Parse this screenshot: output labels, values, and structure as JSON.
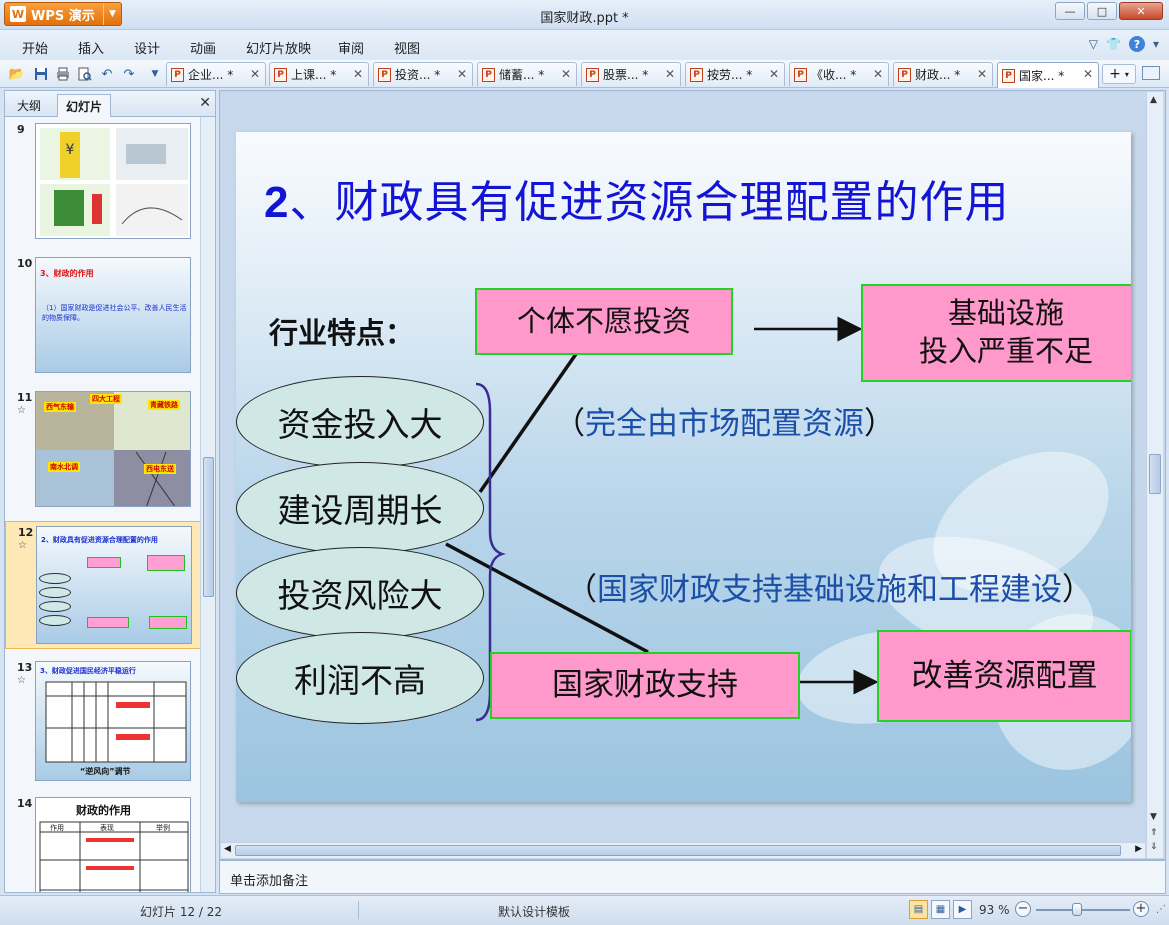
{
  "app": {
    "name": "WPS 演示",
    "logo_letter": "W",
    "window_title": "国家财政.ppt *"
  },
  "window_controls": {
    "minimize": "—",
    "maximize": "□",
    "close": "✕"
  },
  "menu": [
    "开始",
    "插入",
    "设计",
    "动画",
    "幻灯片放映",
    "审阅",
    "视图"
  ],
  "menu_right": {
    "collapse": "▽",
    "skin": "👕",
    "help": "?",
    "help_drop": "▾"
  },
  "quick_access_icons": [
    "open-folder-icon",
    "save-icon",
    "print-icon",
    "print-preview-icon",
    "undo-icon",
    "redo-icon",
    "customize-icon"
  ],
  "doc_tabs": [
    {
      "label": "企业... *",
      "active": false
    },
    {
      "label": "上课... *",
      "active": false
    },
    {
      "label": "投资... *",
      "active": false
    },
    {
      "label": "储蓄... *",
      "active": false
    },
    {
      "label": "股票... *",
      "active": false
    },
    {
      "label": "按劳... *",
      "active": false
    },
    {
      "label": "《收... *",
      "active": false
    },
    {
      "label": "财政... *",
      "active": false
    },
    {
      "label": "国家... *",
      "active": true
    }
  ],
  "left_panel": {
    "tabs": [
      "大纲",
      "幻灯片"
    ],
    "active_tab": "幻灯片",
    "close": "✕",
    "thumbnails": [
      {
        "num": "9",
        "star": false,
        "selected": false
      },
      {
        "num": "10",
        "star": false,
        "selected": false,
        "title": "3、财政的作用",
        "body": "（1）国家财政是促进社会公平、改善人民生活的物质保障。"
      },
      {
        "num": "11",
        "star": true,
        "selected": false,
        "tags": [
          "西气东输",
          "四大工程",
          "青藏铁路",
          "南水北调",
          "西电东送"
        ]
      },
      {
        "num": "12",
        "star": true,
        "selected": true,
        "title": "2、财政具有促进资源合理配置的作用"
      },
      {
        "num": "13",
        "star": true,
        "selected": false,
        "title": "3、财政促进国民经济平稳运行",
        "footer": "“逆风向”调节"
      },
      {
        "num": "14",
        "star": false,
        "selected": false,
        "title": "财政的作用",
        "headers": [
          "作用",
          "表现",
          "举例"
        ]
      }
    ]
  },
  "slide": {
    "title_num": "2",
    "title_text": "、财政具有促进资源合理配置的作用",
    "feature_label": "行业特点：",
    "box_no_invest": "个体不愿投资",
    "box_infra_line1": "基础设施",
    "box_infra_line2": "投入严重不足",
    "note_market_open": "（",
    "note_market": "完全由市场配置资源",
    "note_market_close": "）",
    "ellipses": [
      "资金投入大",
      "建设周期长",
      "投资风险大",
      "利润不高"
    ],
    "note_support_open": "（",
    "note_support": "国家财政支持基础设施和工程建设",
    "note_support_close": "）",
    "box_state_support": "国家财政支持",
    "box_improve": "改善资源配置"
  },
  "notes_placeholder": "单击添加备注",
  "status": {
    "slide_counter": "幻灯片 12 / 22",
    "template": "默认设计模板",
    "zoom": "93 %",
    "zoom_level_percent": 93
  }
}
